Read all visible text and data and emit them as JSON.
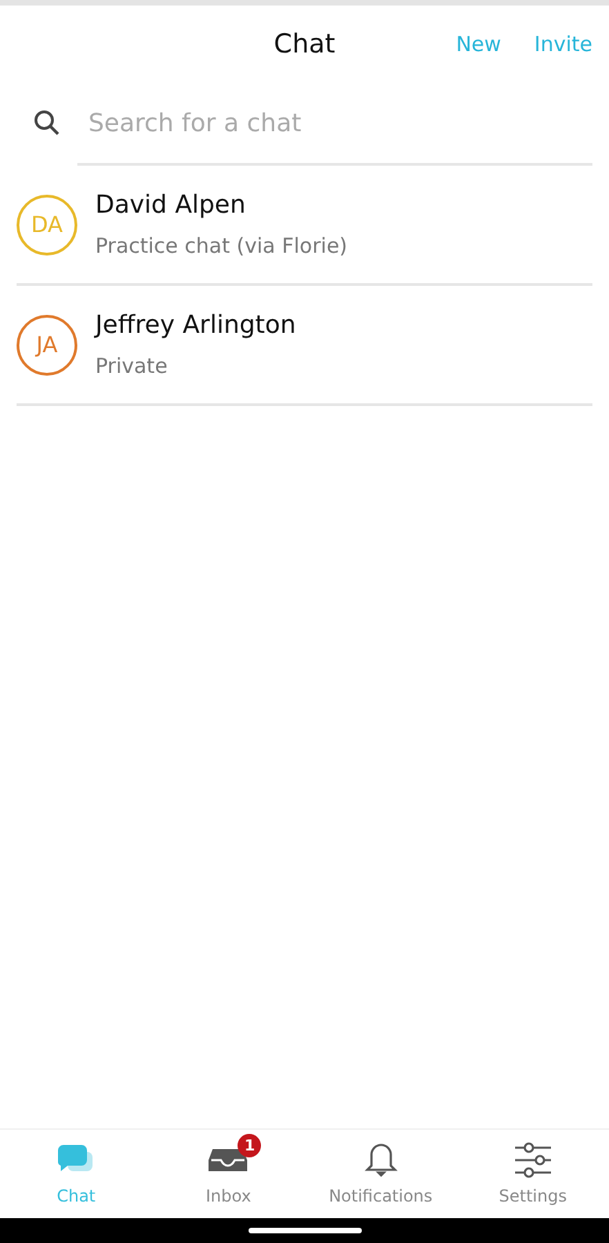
{
  "header": {
    "title": "Chat",
    "actions": [
      "New",
      "Invite"
    ]
  },
  "search": {
    "placeholder": "Search for a chat"
  },
  "chats": [
    {
      "initials": "DA",
      "name": "David Alpen",
      "subtitle": "Practice chat (via Florie)",
      "color": "#e8b92a"
    },
    {
      "initials": "JA",
      "name": "Jeffrey Arlington",
      "subtitle": "Private",
      "color": "#e07a2c"
    }
  ],
  "tabs": [
    {
      "kind": "chat",
      "label": "Chat",
      "selected": true
    },
    {
      "kind": "inbox",
      "label": "Inbox",
      "selected": false,
      "badge": "1"
    },
    {
      "kind": "bell",
      "label": "Notifications",
      "selected": false
    },
    {
      "kind": "sliders",
      "label": "Settings",
      "selected": false
    }
  ]
}
